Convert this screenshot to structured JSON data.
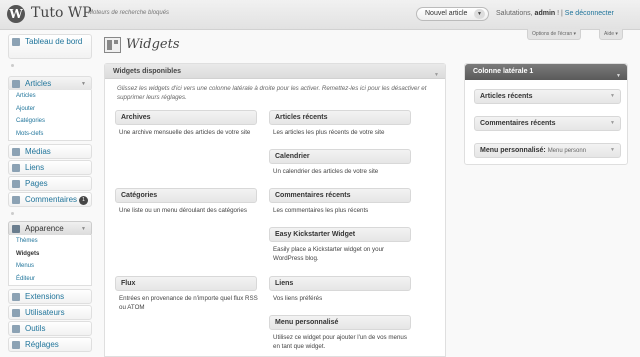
{
  "header": {
    "site_title": "Tuto WP",
    "tagline": "Moteurs de recherche bloqués",
    "new_article": "Nouvel article",
    "greeting": "Salutations,",
    "username": "admin",
    "separator": "! |",
    "logout": "Se déconnecter"
  },
  "screen_options": {
    "options": "Options de l'écran",
    "help": "Aide"
  },
  "sidebar": {
    "dashboard": "Tableau de bord",
    "articles": "Articles",
    "articles_sub": [
      "Articles",
      "Ajouter",
      "Catégories",
      "Mots-clefs"
    ],
    "medias": "Médias",
    "links": "Liens",
    "pages": "Pages",
    "comments": "Commentaires",
    "comments_count": "1",
    "appearance": "Apparence",
    "appearance_sub": [
      "Thèmes",
      "Widgets",
      "Menus",
      "Éditeur"
    ],
    "extensions": "Extensions",
    "users": "Utilisateurs",
    "tools": "Outils",
    "settings": "Réglages"
  },
  "page": {
    "title": "Widgets"
  },
  "available": {
    "title": "Widgets disponibles",
    "description": "Glissez les widgets d'ici vers une colonne latérale à droite pour les activer. Remettez-les ici pour les désactiver et supprimer leurs réglages.",
    "widgets": [
      {
        "name": "Archives",
        "desc": "Une archive mensuelle des articles de votre site"
      },
      {
        "name": "Articles récents",
        "desc": "Les articles les plus récents de votre site"
      },
      {
        "name": "Calendrier",
        "desc": "Un calendrier des articles de votre site"
      },
      {
        "name": "Catégories",
        "desc": "Une liste ou un menu déroulant des catégories"
      },
      {
        "name": "Commentaires récents",
        "desc": "Les commentaires les plus récents"
      },
      {
        "name": "Easy Kickstarter Widget",
        "desc": "Easily place a Kickstarter widget on your WordPress blog."
      },
      {
        "name": "Flux",
        "desc": "Entrées en provenance de n'importe quel flux RSS ou ATOM"
      },
      {
        "name": "Liens",
        "desc": "Vos liens préférés"
      },
      {
        "name": "Menu personnalisé",
        "desc": "Utilisez ce widget pour ajouter l'un de vos menus en tant que widget."
      }
    ]
  },
  "sidebar_panel": {
    "title": "Colonne latérale 1",
    "widgets": [
      "Articles récents",
      "Commentaires récents"
    ],
    "menu_widget": "Menu personnalisé:",
    "menu_widget_sub": "Menu personn"
  }
}
